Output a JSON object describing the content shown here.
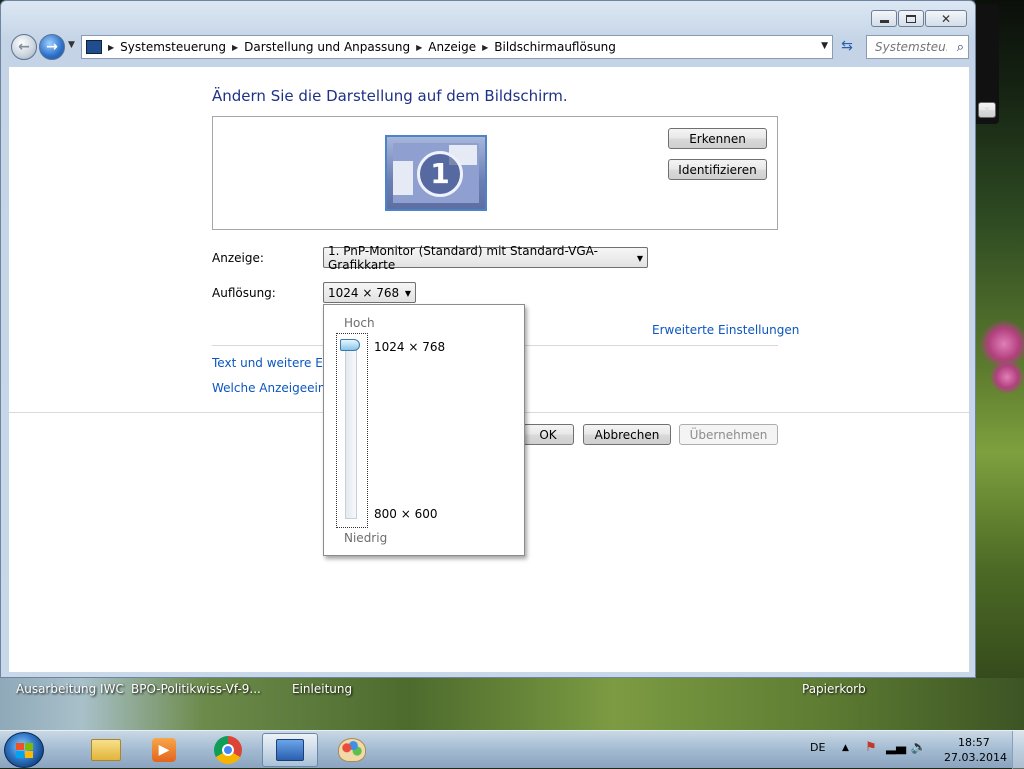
{
  "window": {
    "breadcrumbs": [
      "Systemsteuerung",
      "Darstellung und Anpassung",
      "Anzeige",
      "Bildschirmauflösung"
    ],
    "search_placeholder": "Systemsteu..."
  },
  "content": {
    "heading": "Ändern Sie die Darstellung auf dem Bildschirm.",
    "monitor_number": "1",
    "erkennen_label": "Erkennen",
    "identifizieren_label": "Identifizieren",
    "anzeige_label": "Anzeige:",
    "anzeige_value": "1. PnP-Monitor (Standard) mit Standard-VGA-Grafikkarte",
    "aufloesung_label": "Auflösung:",
    "aufloesung_value": "1024 × 768",
    "erweiterte_link": "Erweiterte Einstellungen",
    "text_link": "Text und weitere Elen",
    "welche_link": "Welche Anzeigeeinste",
    "ok_label": "OK",
    "abbrechen_label": "Abbrechen",
    "uebernehmen_label": "Übernehmen"
  },
  "resolution_popup": {
    "high_label": "Hoch",
    "low_label": "Niedrig",
    "top_value": "1024 × 768",
    "bottom_value": "800 × 600",
    "slider_level": 1.0
  },
  "desktop": {
    "labels": [
      "Ausarbeitung IWC",
      "BPO-Politikwiss-Vf-9...",
      "Einleitung",
      "Papierkorb"
    ]
  },
  "taskbar": {
    "language": "DE",
    "time": "18:57",
    "date": "27.03.2014",
    "items": [
      "file-explorer-icon",
      "media-player-icon",
      "chrome-icon",
      "control-panel-icon",
      "paint-icon"
    ]
  },
  "colors": {
    "heading": "#1e3287",
    "link": "#0b56bf",
    "disabled_text": "#8d8d8d"
  }
}
